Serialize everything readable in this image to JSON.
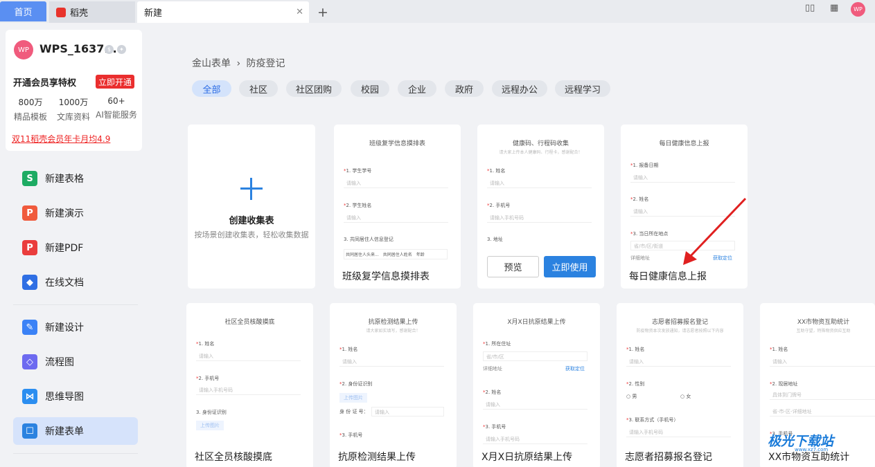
{
  "tabs": {
    "home": "首页",
    "daoke": "稻壳",
    "new": "新建"
  },
  "topright": {
    "avatar": "WP"
  },
  "user": {
    "avatar": "WP",
    "name": "WPS_1637...",
    "vip_text": "开通会员享特权",
    "vip_button": "立即开通",
    "stats": [
      {
        "num": "800万",
        "label": "精品模板"
      },
      {
        "num": "1000万",
        "label": "文库资料"
      },
      {
        "num": "60+",
        "label": "AI智能服务"
      }
    ],
    "promo": "双11稻壳会员年卡月均4.9"
  },
  "nav": [
    {
      "label": "新建表格",
      "icon": "spreadsheet-icon",
      "color": "#1dab63"
    },
    {
      "label": "新建演示",
      "icon": "presentation-icon",
      "color": "#f05a3c"
    },
    {
      "label": "新建PDF",
      "icon": "pdf-icon",
      "color": "#ea3d3d"
    },
    {
      "label": "在线文档",
      "icon": "online-doc-icon",
      "color": "#2f6fe4"
    },
    {
      "label": "新建设计",
      "icon": "design-icon",
      "color": "#3b82f6"
    },
    {
      "label": "流程图",
      "icon": "flowchart-icon",
      "color": "#6d6af0"
    },
    {
      "label": "思维导图",
      "icon": "mindmap-icon",
      "color": "#2b8ef0"
    },
    {
      "label": "新建表单",
      "icon": "form-icon",
      "color": "#2b82e0"
    }
  ],
  "breadcrumb": {
    "root": "金山表单",
    "sep": "›",
    "current": "防疫登记"
  },
  "chips": [
    "全部",
    "社区",
    "社区团购",
    "校园",
    "企业",
    "政府",
    "远程办公",
    "远程学习"
  ],
  "create_card": {
    "title": "创建收集表",
    "subtitle": "按场景创建收集表，轻松收集数据"
  },
  "templates": [
    {
      "title": "班级复学信息摸排表",
      "preview_title": "班级复学信息摸排表"
    },
    {
      "title": "",
      "preview_title": "健康码、行程码收集",
      "preview_sub": "请大家上传本人健康码、行程卡，感谢配合！",
      "btn_preview": "预览",
      "btn_use": "立即使用"
    },
    {
      "title": "每日健康信息上报",
      "preview_title": "每日健康信息上报"
    },
    {
      "title": "社区全员核酸摸底",
      "preview_title": "社区全员核酸摸底"
    },
    {
      "title": "抗原检测结果上传",
      "preview_title": "抗原检测结果上传",
      "preview_sub": "请大家如实填写，感谢配合！"
    },
    {
      "title": "X月X日抗原结果上传",
      "preview_title": "X月X日抗原结果上传"
    },
    {
      "title": "志愿者招募报名登记",
      "preview_title": "志愿者招募报名登记",
      "preview_sub": "防疫物资本次发放通知，请志愿者按照以下内容"
    },
    {
      "title": "XX市物资互助统计",
      "preview_title": "XX市物资互助统计",
      "preview_sub": "互助守望，特殊物资供应互助"
    }
  ],
  "fields": {
    "t1": [
      "1. 学生学号",
      "请输入",
      "2. 学生姓名",
      "请输入",
      "3. 共同居住人信息登记",
      "共同居住人头来...",
      "共同居住人姓名",
      "年龄"
    ],
    "t2": [
      "1. 姓名",
      "请输入",
      "2. 手机号",
      "请输入手机号码",
      "3. 地址"
    ],
    "t3": [
      "1. 报备日期",
      "请输入",
      "2. 姓名",
      "请输入",
      "3. 当日所在地点",
      "省/市/区/街道",
      "详细地址",
      "获取定位"
    ],
    "t4": [
      "1. 姓名",
      "请输入",
      "2. 手机号",
      "请输入手机号码",
      "3. 身份证识别",
      "上传图片"
    ],
    "t5": [
      "1. 姓名",
      "请输入",
      "2. 身份证识别",
      "上传图片",
      "身 份 证 号：",
      "请输入",
      "3. 手机号"
    ],
    "t6": [
      "1. 所在住址",
      "省/市/区",
      "详细地址",
      "获取定位",
      "2. 姓名",
      "请输入",
      "3. 手机号",
      "请输入手机号码"
    ],
    "t7": [
      "1. 姓名",
      "请输入",
      "2. 性别",
      "男",
      "女",
      "3. 联系方式（手机号）",
      "请输入手机号码"
    ],
    "t8": [
      "1. 姓名",
      "请输入",
      "2. 现居地址",
      "具体到门牌号",
      "省-市-区-详细地址",
      "3. 手机号"
    ]
  },
  "watermark": {
    "text": "极光下载站",
    "url": "www.xz7.com"
  }
}
